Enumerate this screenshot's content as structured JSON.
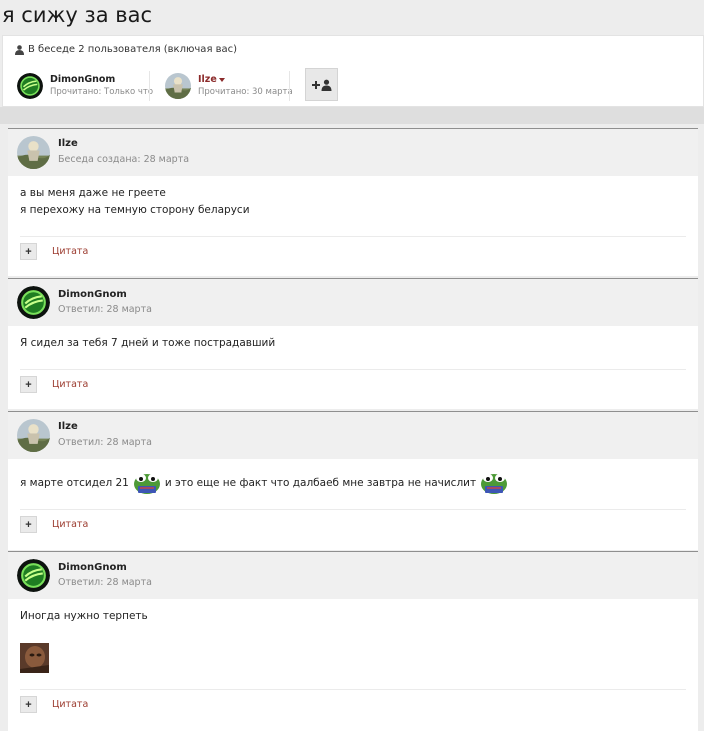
{
  "page": {
    "title": "я сижу за вас"
  },
  "participants": {
    "heading": "В беседе 2 пользователя (включая вас)",
    "users": [
      {
        "name": "DimonGnom",
        "read": "Прочитано: Только что"
      },
      {
        "name": "Ilze",
        "read": "Прочитано: 30 марта"
      }
    ]
  },
  "posts": [
    {
      "author": "Ilze",
      "date": "Беседа создана: 28 марта",
      "lines": [
        "а вы меня даже не греете",
        "я перехожу на темную сторону беларуси"
      ],
      "quote_label": "Цитата"
    },
    {
      "author": "DimonGnom",
      "date": "Ответил: 28 марта",
      "lines": [
        "Я сидел за тебя 7 дней и тоже пострадавший"
      ],
      "quote_label": "Цитата"
    },
    {
      "author": "Ilze",
      "date": "Ответил: 28 марта",
      "text_part1": "я марте отсидел 21",
      "text_part2": "и это еще не факт что далбаеб мне завтра не начислит",
      "quote_label": "Цитата"
    },
    {
      "author": "DimonGnom",
      "date": "Ответил: 28 марта",
      "lines": [
        "Иногда нужно терпеть"
      ],
      "quote_label": "Цитата"
    }
  ]
}
